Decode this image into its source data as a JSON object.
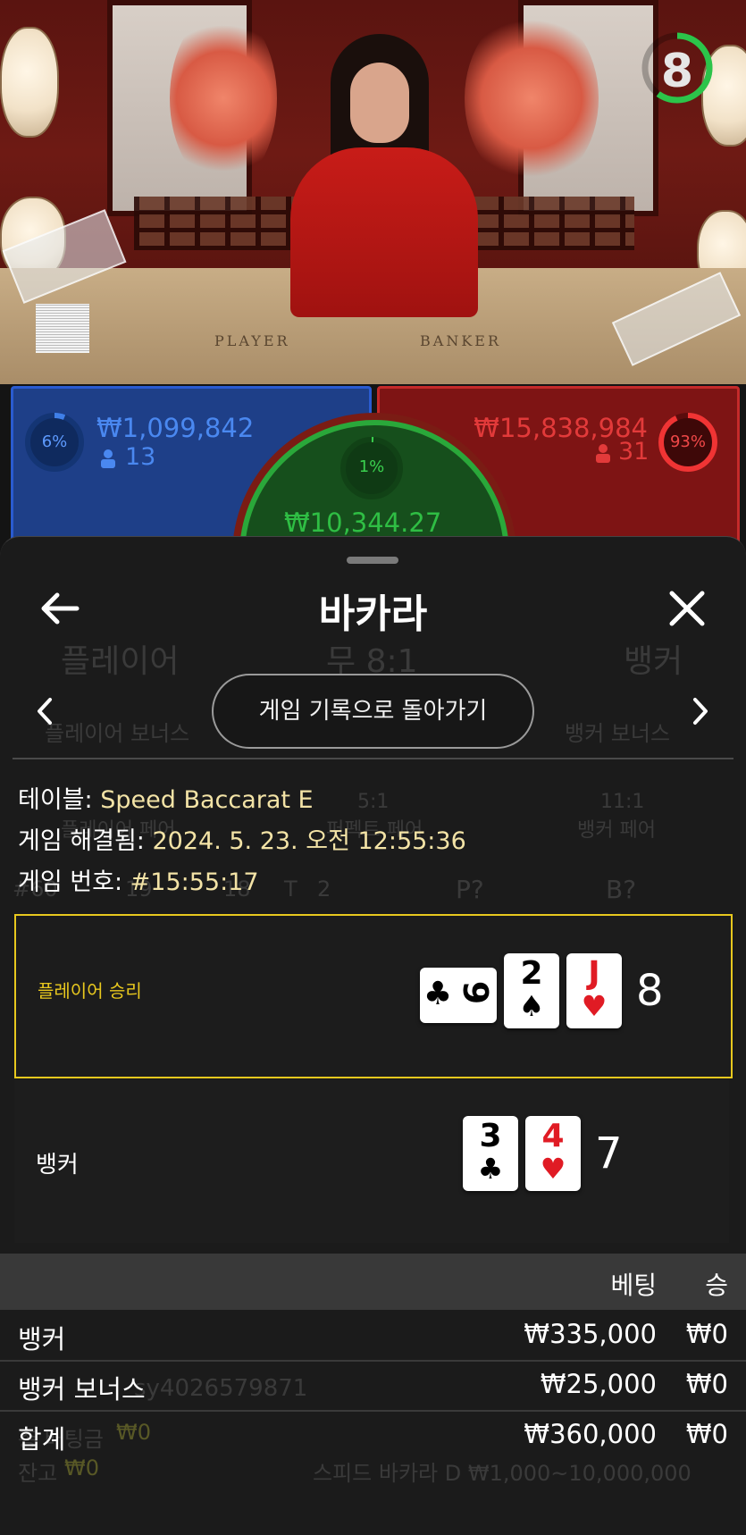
{
  "timer": {
    "value": "8",
    "progress": 0.6,
    "color": "#2cc44a"
  },
  "video": {
    "player_text": "PLAYER",
    "banker_text": "BANKER"
  },
  "player_stats": {
    "percent": "6%",
    "amount": "₩1,099,842",
    "count": "13",
    "color": "#2a5bd0"
  },
  "tie_stats": {
    "percent": "1%",
    "amount": "₩10,344.27",
    "color": "#2aa83a"
  },
  "banker_stats": {
    "percent": "93%",
    "amount": "₩15,838,984",
    "count": "31",
    "color": "#e03030"
  },
  "sheet": {
    "title": "바카라",
    "back_icon": "arrow-left-icon",
    "close_icon": "close-icon",
    "history_button": "게임 기록으로 돌아가기",
    "ghost": {
      "player": "플레이어",
      "tie": "무 8:1",
      "banker": "뱅커",
      "player_bonus": "플레이어 보너스",
      "banker_bonus": "뱅커 보너스",
      "player_pair_odds": "11:1",
      "player_pair": "플레이어 페어",
      "perfect_odds": "5:1",
      "perfect_pair": "퍼펙트 페어",
      "banker_pair_odds": "11:1",
      "banker_pair": "뱅커 페어",
      "round_count": "#60",
      "p_count": "19",
      "b_count": "18",
      "t_label": "T",
      "t_count": "2",
      "p_predict": "P?",
      "b_predict": "B?",
      "username": "sy4026579871",
      "balance_label": "잔고",
      "balance_value": "₩0",
      "total_bet_label": "총 배팅금",
      "total_bet_value": "₩0",
      "table_limit": "스피드 바카라 D  ₩1,000~10,000,000"
    },
    "info": {
      "table_label": "테이블:",
      "table_value": "Speed Baccarat E",
      "resolved_label": "게임 해결됨:",
      "resolved_value": "2024. 5. 23. 오전 12:55:36",
      "number_label": "게임 번호:",
      "number_value": "#15:55:17"
    },
    "player": {
      "result_label": "플레이어 승리",
      "cards": [
        {
          "rank": "9",
          "suit": "♣",
          "color": "black",
          "rotated": true
        },
        {
          "rank": "2",
          "suit": "♠",
          "color": "black"
        },
        {
          "rank": "J",
          "suit": "♥",
          "color": "red"
        }
      ],
      "score": "8"
    },
    "banker": {
      "label": "뱅커",
      "cards": [
        {
          "rank": "3",
          "suit": "♣",
          "color": "black"
        },
        {
          "rank": "4",
          "suit": "♥",
          "color": "red"
        }
      ],
      "score": "7"
    },
    "bets": {
      "header_bet": "베팅",
      "header_win": "승",
      "rows": [
        {
          "name": "뱅커",
          "bet": "₩335,000",
          "win": "₩0"
        },
        {
          "name": "뱅커 보너스",
          "bet": "₩25,000",
          "win": "₩0"
        },
        {
          "name": "합계",
          "bet": "₩360,000",
          "win": "₩0"
        }
      ]
    }
  }
}
